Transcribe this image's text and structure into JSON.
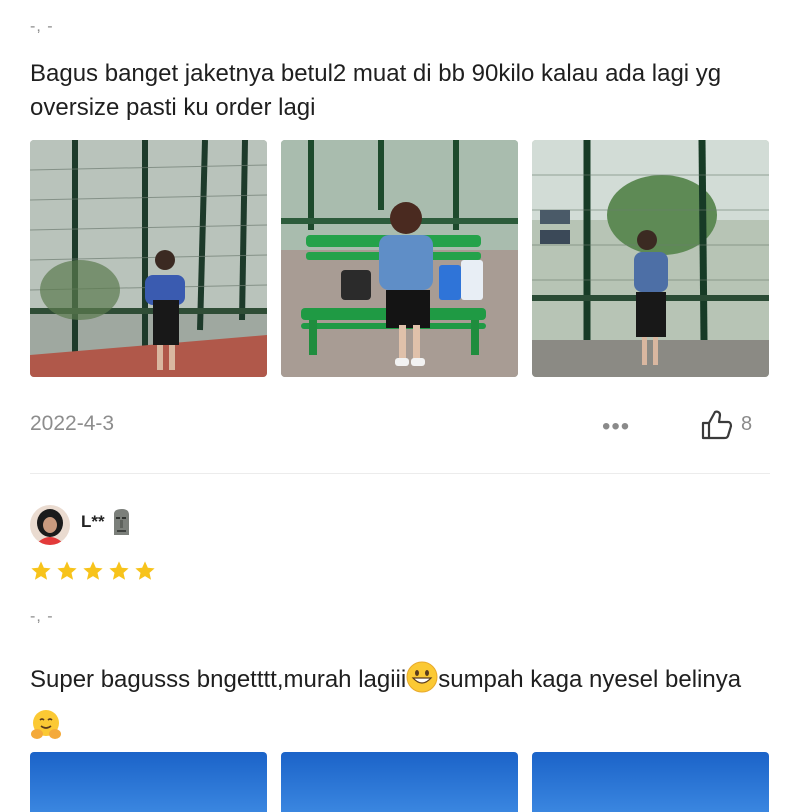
{
  "review1": {
    "variant": "-, -",
    "text": "Bagus banget jaketnya betul2 muat di bb 90kilo kalau ada lagi yg oversize pasti ku order lagi",
    "date": "2022-4-3",
    "more_label": "•••",
    "like_count": "8",
    "photo_count": 3
  },
  "review2": {
    "username": "L**",
    "rating": 5,
    "variant": "-, -",
    "text_part1": "Super bagusss bngetttt,murah lagiii",
    "text_part2": "sumpah kaga nyesel belinya",
    "emoji1": "grinning-face",
    "emoji2": "hugging-face",
    "photo_count": 3
  },
  "colors": {
    "star": "#f7c31b",
    "muted_text": "#8d8d8d",
    "divider": "#ececec"
  }
}
